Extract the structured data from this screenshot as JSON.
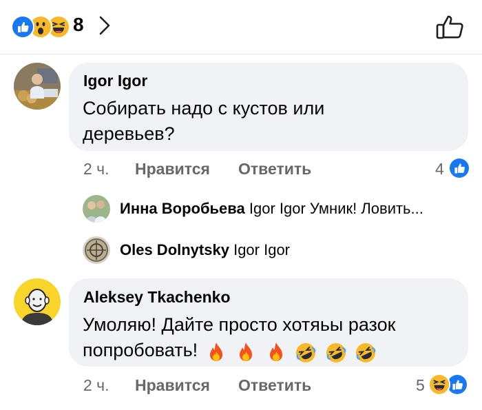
{
  "header": {
    "reaction_count": "8",
    "reaction_icons": [
      "like-icon",
      "wow-icon",
      "haha-icon"
    ]
  },
  "comments": [
    {
      "author": "Igor Igor",
      "text_line1": "Собирать надо с кустов или",
      "text_line2": "деревьев?",
      "time": "2 ч.",
      "like_label": "Нравится",
      "reply_label": "Ответить",
      "reaction_count": "4",
      "reaction_icon": "like-icon"
    },
    {
      "author": "Aleksey Tkachenko",
      "text_line1": "Умоляю! Дайте просто хотяьы разок",
      "text_line2": "попробовать!",
      "emojis": [
        "fire",
        "fire",
        "fire",
        "rofl",
        "rofl",
        "rofl"
      ],
      "time": "2 ч.",
      "like_label": "Нравится",
      "reply_label": "Ответить",
      "reaction_count": "5",
      "reaction_icons": [
        "haha-icon",
        "like-icon"
      ]
    }
  ],
  "replies": [
    {
      "author": "Инна Воробьева",
      "text": "Igor Igor Умник! Ловить..."
    },
    {
      "author": "Oles Dolnytsky",
      "text": "Igor Igor"
    }
  ],
  "colors": {
    "like_blue": "#1877f2",
    "bubble_bg": "#f0f2f5",
    "meta_gray": "#65676b",
    "emoji_yellow": "#f7b928"
  }
}
